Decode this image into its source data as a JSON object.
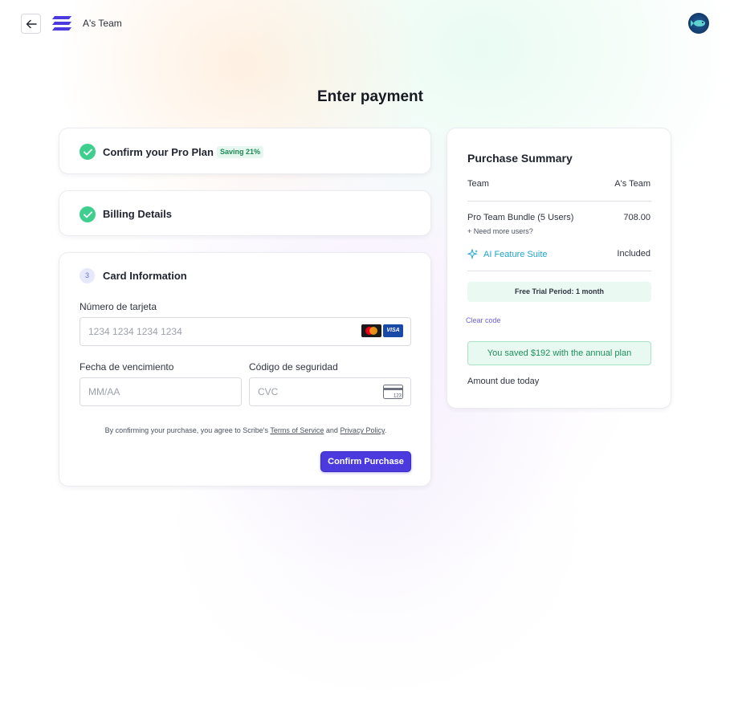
{
  "header": {
    "team_name": "A's Team"
  },
  "page_title": "Enter payment",
  "steps": {
    "confirm_plan": {
      "title": "Confirm your Pro Plan",
      "badge": "Saving 21%"
    },
    "billing": {
      "title": "Billing Details"
    },
    "card_info": {
      "number": "3",
      "title": "Card Information",
      "card_number_label": "Número de tarjeta",
      "card_number_placeholder": "1234 1234 1234 1234",
      "expiry_label": "Fecha de vencimiento",
      "expiry_placeholder": "MM/AA",
      "cvc_label": "Código de seguridad",
      "cvc_placeholder": "CVC",
      "cvc_icon_text": "123",
      "visa_text": "VISA",
      "legal_prefix": "By confirming your purchase, you agree to Scribe's",
      "terms_link": "Terms of Service",
      "legal_and": "and",
      "privacy_link": "Privacy Policy",
      "legal_suffix": ".",
      "confirm_button": "Confirm Purchase"
    }
  },
  "summary": {
    "title": "Purchase Summary",
    "team_label": "Team",
    "team_value": "A's Team",
    "bundle_label": "Pro Team Bundle (5 Users)",
    "bundle_value": "708.00",
    "more_users": "+ Need more users?",
    "ai_label": "AI Feature Suite",
    "ai_value": "Included",
    "trial": "Free Trial Period: 1 month",
    "clear_code": "Clear code",
    "saved": "You saved $192 with the annual plan",
    "amount_due": "Amount due today"
  },
  "colors": {
    "primary": "#4b3bdf",
    "success": "#3ecf8e",
    "ai_accent": "#1fa3c9"
  }
}
